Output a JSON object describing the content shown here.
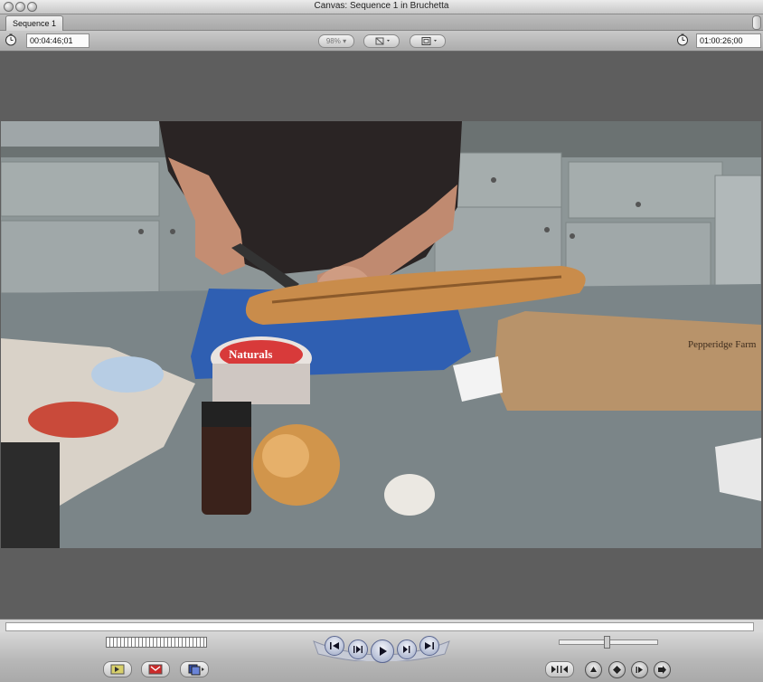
{
  "window": {
    "title": "Canvas: Sequence 1 in Bruchetta"
  },
  "tabs": [
    {
      "label": "Sequence 1"
    }
  ],
  "toolbar": {
    "duration_timecode": "00:04:46;01",
    "zoom_label": "98%",
    "current_timecode": "01:00:26;00"
  },
  "video": {
    "description_icons": [
      "baguette-icon",
      "cutting-board-icon",
      "onion-icon",
      "garlic-icon",
      "bread-bag-icon"
    ],
    "tub_label": "Naturals",
    "bag_text": "Pepperidge Farm"
  },
  "colors": {
    "frame_bg": "#5e5e5e",
    "cutting_board": "#2f5fb2",
    "counter": "#7b8588",
    "transport_blue": "#9aa6c4",
    "mark_in_yellow": "#d8d06a",
    "mark_red": "#cc2b2b"
  }
}
